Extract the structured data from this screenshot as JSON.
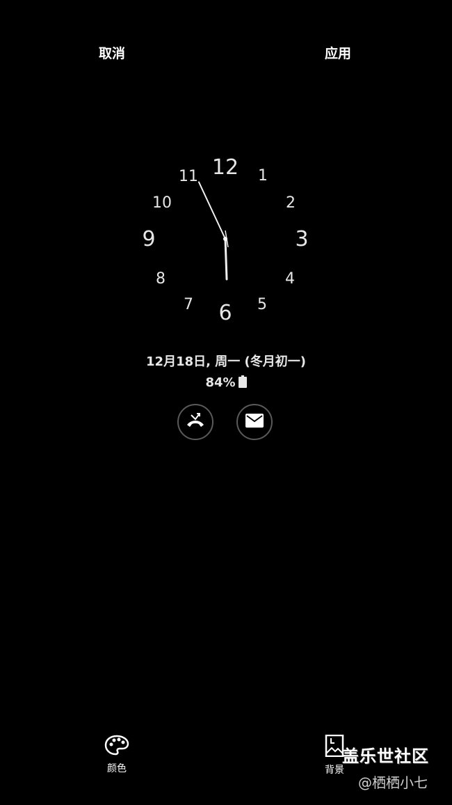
{
  "header": {
    "cancel_label": "取消",
    "apply_label": "应用"
  },
  "clock": {
    "numerals": [
      "12",
      "1",
      "2",
      "3",
      "4",
      "5",
      "6",
      "7",
      "8",
      "9",
      "10",
      "11"
    ],
    "hour_hand_angle_deg": 178,
    "minute_hand_angle_deg": 335
  },
  "status": {
    "date_text": "12月18日, 周一 (冬月初一)",
    "battery_text": "84%"
  },
  "notifications": {
    "items": [
      {
        "icon": "missed-call-icon"
      },
      {
        "icon": "message-icon"
      }
    ]
  },
  "bottom_bar": {
    "color_label": "颜色",
    "background_label": "背景"
  },
  "watermark": {
    "title": "盖乐世社区",
    "user": "@栖栖小七"
  },
  "colors": {
    "background": "#000000",
    "text": "#ffffff",
    "ring": "#5a5a5a"
  }
}
